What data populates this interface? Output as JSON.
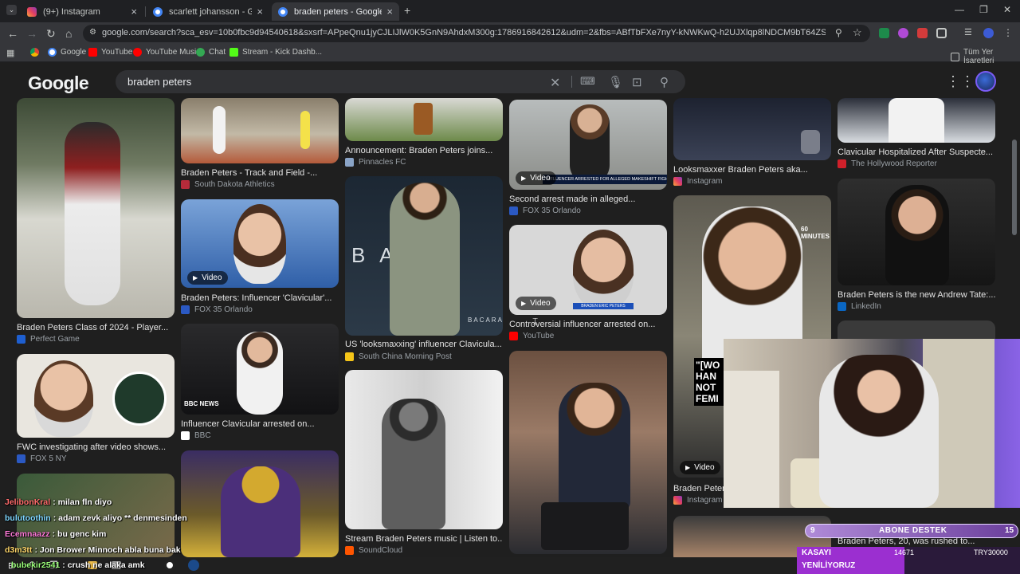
{
  "tabs": [
    {
      "title": "(9+) Instagram",
      "active": false
    },
    {
      "title": "scarlett johansson - Google'da Ara",
      "active": false
    },
    {
      "title": "braden peters - Google'da Ara",
      "active": true
    }
  ],
  "new_tab_label": "+",
  "address_bar": {
    "url": "google.com/search?sca_esv=10b0fbc9d94540618&sxsrf=APpeQnu1jyCJLIJlW0K5GnN9AhdxM300g:1786916842612&udm=2&fbs=ABfTbFXe7nyY-kNWKwQ-h2UJXlqp8lNDCM9bT64ZSPFlq12ABgHn6ltrU8OgM4ibkkLR8R..."
  },
  "bookmarks": [
    {
      "label": "Google"
    },
    {
      "label": "YouTube"
    },
    {
      "label": "YouTube Music"
    },
    {
      "label": "Chat"
    },
    {
      "label": "Stream - Kick Dashb..."
    }
  ],
  "all_bookmarks_label": "Tüm Yer İşaretleri",
  "google": {
    "logo": "Google",
    "query": "braden peters"
  },
  "results": [
    {
      "caption": "Braden Peters Class of 2024 - Player...",
      "source": "Perfect Game",
      "video": false
    },
    {
      "caption": "FWC investigating after video shows...",
      "source": "FOX 5 NY",
      "video": false
    },
    {
      "caption": "Braden Peters - Track and Field -...",
      "source": "South Dakota Athletics",
      "video": false
    },
    {
      "caption": "Braden Peters: Influencer 'Clavicular'...",
      "source": "FOX 35 Orlando",
      "video": true
    },
    {
      "caption": "Influencer Clavicular arrested on...",
      "source": "BBC",
      "video": false
    },
    {
      "caption": "Announcement: Braden Peters joins...",
      "source": "Pinnacles FC",
      "video": false
    },
    {
      "caption": "US 'looksmaxxing' influencer Clavicula...",
      "source": "South China Morning Post",
      "video": false
    },
    {
      "caption": "Stream Braden Peters music | Listen to...",
      "source": "SoundCloud",
      "video": false
    },
    {
      "caption": "Second arrest made in alleged...",
      "source": "FOX 35 Orlando",
      "video": true
    },
    {
      "caption": "Controversial influencer arrested on...",
      "source": "YouTube",
      "video": true
    },
    {
      "caption": "Looksmaxxer Braden Peters aka...",
      "source": "Instagram",
      "video": false
    },
    {
      "caption": "Braden Peters",
      "source": "Instagram",
      "video": true
    },
    {
      "caption": "Clavicular Hospitalized After Suspecte...",
      "source": "The Hollywood Reporter",
      "video": false
    },
    {
      "caption": "Braden Peters is the new Andrew Tate:...",
      "source": "LinkedIn",
      "video": false
    },
    {
      "caption": "Braden Peters, 20, was rushed to...",
      "source": "",
      "video": false
    }
  ],
  "video_badge_label": "Video",
  "overlay_texts": {
    "bacarat": "B A     A",
    "bacarat_small": "BACARA",
    "news_banner": "INFLUENCER ARRESTED FOR ALLEGED MAKESHIFT FIGHT CLUB",
    "bbc": "BBC NEWS",
    "minutes": "60 MINUTES",
    "quote": "\"[WO HAN NOT FEMI",
    "mugshot_label": "BRADEN ERIC PETERS"
  },
  "chat": [
    {
      "user": "JelibonKral",
      "message": ": milan fln diyo",
      "color": "#ff6b6b"
    },
    {
      "user": "bulutoothin",
      "message": ": adam zevk aliyo ** denmesinden",
      "color": "#7fd7ff"
    },
    {
      "user": "Ecemnaazz",
      "message": ": bu genc kim",
      "color": "#ff7ad9"
    },
    {
      "user": "d3m3tt",
      "message": ": Jon Brower Minnoch abla buna bak",
      "color": "#ffd76b"
    },
    {
      "user": "bubekir2541",
      "message": ": crush ne alaka amk",
      "color": "#9bff7a"
    }
  ],
  "stream_overlay": {
    "sub_goal_label": "ABONE DESTEK",
    "sub_goal_left": "9",
    "sub_goal_right": "15",
    "kasayi": "KASAYI",
    "yenili": "YENİLİYORUZ",
    "count_a": "14671",
    "count_b": "TRY30000"
  },
  "colors": {
    "page_bg": "#1f1f1f",
    "search_bg": "#303134",
    "accent_purple": "#8a63e6"
  }
}
